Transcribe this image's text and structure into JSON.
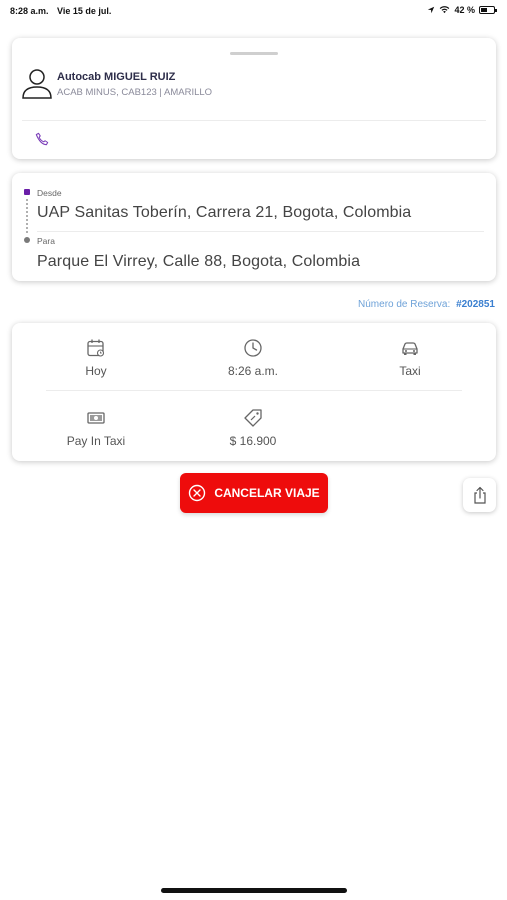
{
  "status_bar": {
    "time": "8:28 a.m.",
    "date": "Vie 15 de jul.",
    "battery": "42 %"
  },
  "driver": {
    "name": "Autocab MIGUEL RUIZ",
    "vehicle": "ACAB MINUS, CAB123 | AMARILLO",
    "avatar_icon": "user-avatar-icon",
    "phone_icon": "phone-icon"
  },
  "route": {
    "from_label": "Desde",
    "from_address": "UAP Sanitas Toberín, Carrera 21, Bogota, Colombia",
    "to_label": "Para",
    "to_address": "Parque El Virrey, Calle 88, Bogota, Colombia"
  },
  "reservation": {
    "label": "Número de Reserva:",
    "number": "#202851"
  },
  "details": {
    "date": "Hoy",
    "time": "8:26 a.m.",
    "vehicle_type": "Taxi",
    "payment": "Pay In Taxi",
    "price": "$ 16.900"
  },
  "actions": {
    "cancel_label": "CANCELAR VIAJE"
  },
  "colors": {
    "cancel_red": "#ee0c0c",
    "accent_purple": "#6a1fa8",
    "reservation_blue": "#3a7fd0"
  }
}
